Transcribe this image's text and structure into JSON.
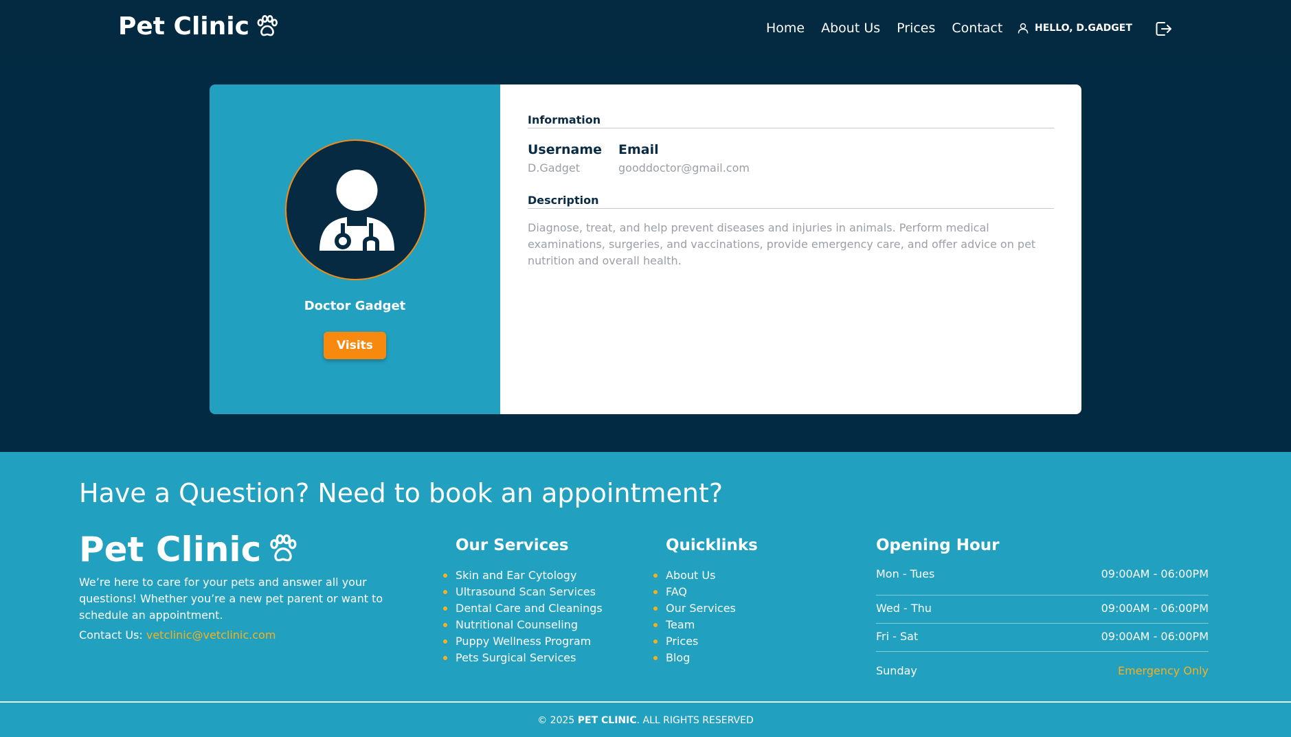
{
  "header": {
    "logo": "Pet Clinic",
    "nav": [
      "Home",
      "About Us",
      "Prices",
      "Contact"
    ],
    "greeting": "HELLO, D.GADGET"
  },
  "profile": {
    "name": "Doctor Gadget",
    "visits_label": "Visits",
    "info_title": "Information",
    "username_label": "Username",
    "username": "D.Gadget",
    "email_label": "Email",
    "email": "gooddoctor@gmail.com",
    "description_title": "Description",
    "description": "Diagnose, treat, and help prevent diseases and injuries in animals. Perform medical examinations, surgeries, and vaccinations, provide emergency care, and offer advice on pet nutrition and overall health."
  },
  "footer": {
    "question": "Have a Question? Need to book an appointment?",
    "logo": "Pet Clinic",
    "about": "We’re here to care for your pets and answer all your questions! Whether you’re a new pet parent or want to schedule an appointment.",
    "contact_label": "Contact Us: ",
    "contact_email": "vetclinic@vetclinic.com",
    "services_title": "Our Services",
    "services": [
      "Skin and Ear Cytology",
      "Ultrasound Scan Services",
      "Dental Care and Cleanings",
      "Nutritional Counseling",
      "Puppy Wellness Program",
      "Pets Surgical Services"
    ],
    "quicklinks_title": "Quicklinks",
    "quicklinks": [
      "About Us",
      "FAQ",
      "Our Services",
      "Team",
      "Prices",
      "Blog"
    ],
    "hours_title": "Opening Hour",
    "hours": [
      {
        "day": "Mon - Tues",
        "time": "09:00AM - 06:00PM"
      },
      {
        "day": "Wed - Thu",
        "time": "09:00AM - 06:00PM"
      },
      {
        "day": "Fri - Sat",
        "time": "09:00AM - 06:00PM"
      },
      {
        "day": "Sunday",
        "time": "Emergency Only"
      }
    ],
    "copyright_prefix": "© 2025 ",
    "copyright_brand": "PET CLINIC",
    "copyright_suffix": ". ALL RIGHTS RESERVED"
  },
  "colors": {
    "navy": "#022a42",
    "teal": "#22a0c0",
    "orange": "#f7890f",
    "gold": "#f7b01e"
  },
  "icons": [
    "paw-icon",
    "user-icon",
    "logout-icon",
    "doctor-avatar-icon"
  ]
}
